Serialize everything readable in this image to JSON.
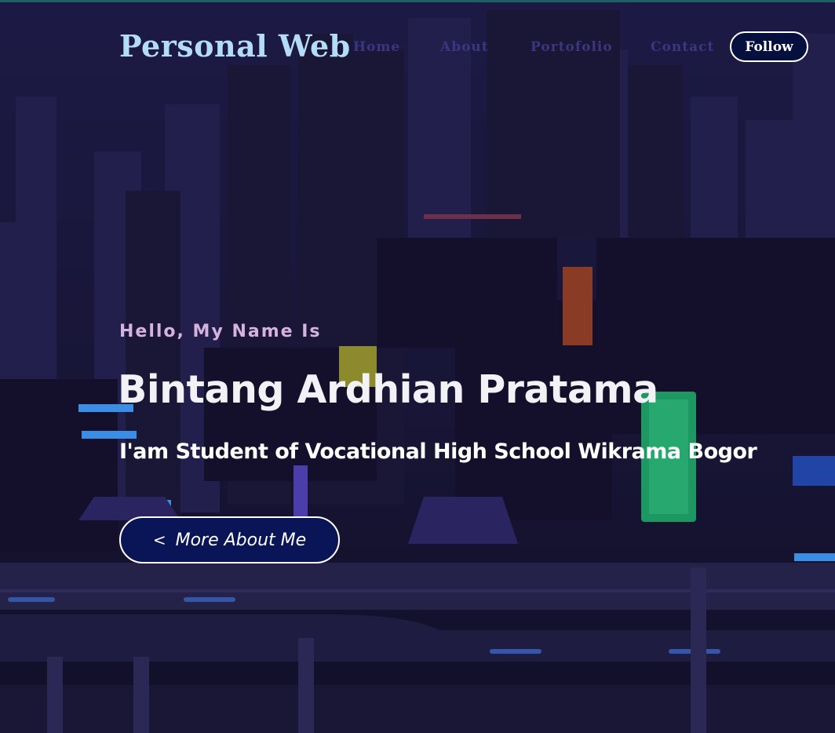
{
  "header": {
    "brand": "Personal Web",
    "nav": [
      "Home",
      "About",
      "Portofolio",
      "Contact"
    ],
    "follow_label": "Follow"
  },
  "hero": {
    "greeting": "Hello, My Name Is",
    "name": "Bintang Ardhian Pratama",
    "subtitle": "I'am Student of Vocational High School Wikrama Bogor",
    "cta_label": "More About Me",
    "cta_icon": "chevron-left-icon"
  },
  "colors": {
    "background": "#161434",
    "brand": "#b3dcf9",
    "nav_link": "#3b3680",
    "greeting": "#d6b2de",
    "button_bg": "#0a1557"
  }
}
